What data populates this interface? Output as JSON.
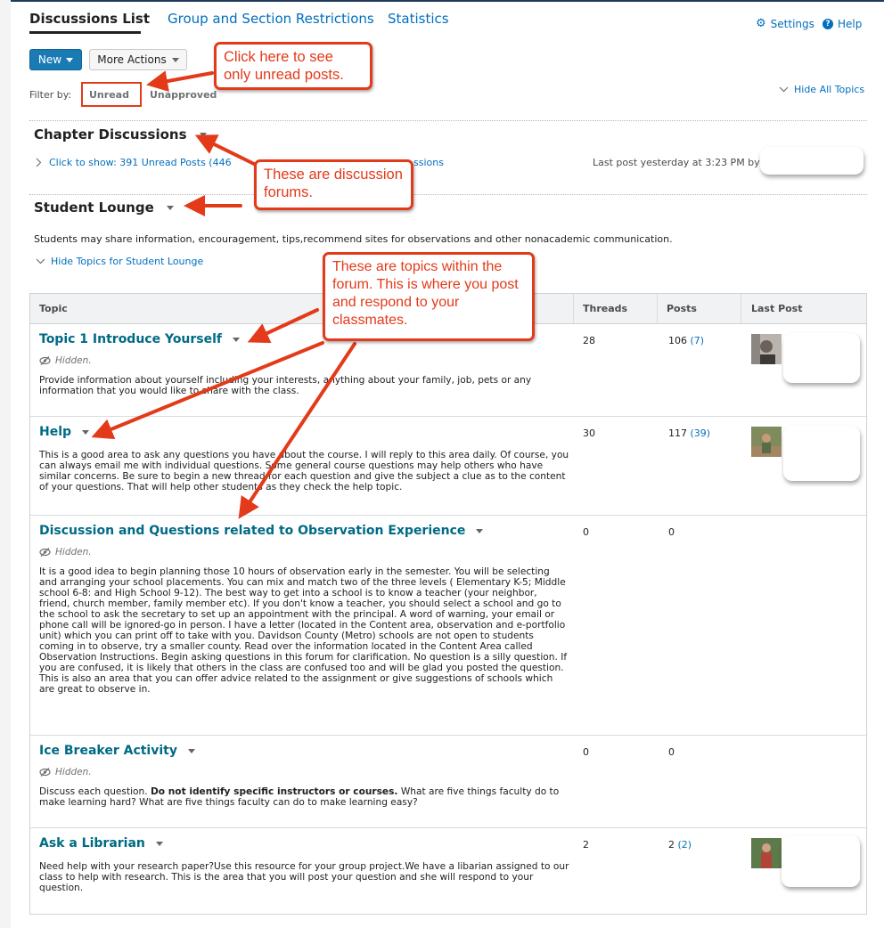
{
  "nav": {
    "tabs": [
      {
        "label": "Discussions List",
        "active": true
      },
      {
        "label": "Group and Section Restrictions",
        "active": false
      },
      {
        "label": "Statistics",
        "active": false
      }
    ],
    "settings_label": "Settings",
    "help_label": "Help"
  },
  "toolbar": {
    "new_label": "New",
    "more_actions_label": "More Actions"
  },
  "filter": {
    "label": "Filter by:",
    "unread": "Unread",
    "unapproved": "Unapproved"
  },
  "hide_all_topics": "Hide All Topics",
  "forums": {
    "chapter": {
      "title": "Chapter Discussions",
      "show_link": "Click to show: 391 Unread Posts (446",
      "show_link_tail": "ssions",
      "last_post": "Last post yesterday at 3:23 PM by"
    },
    "lounge": {
      "title": "Student Lounge",
      "description": "Students may share information, encouragement, tips,recommend sites for observations and other nonacademic communication.",
      "hide_link": "Hide Topics for Student Lounge"
    }
  },
  "table": {
    "headers": {
      "topic": "Topic",
      "threads": "Threads",
      "posts": "Posts",
      "last_post": "Last Post"
    },
    "rows": [
      {
        "title": "Topic 1 Introduce Yourself",
        "hidden": "Hidden.",
        "description": "Provide information about yourself including your interests, anything about your family, job, pets or any information that you would like to share with the class.",
        "threads": "28",
        "posts": "106",
        "unread": "(7)"
      },
      {
        "title": "Help",
        "description": "This is a good area to ask any questions you have about the course. I will reply to this area daily. Of course, you can always email me with individual questions. Some general course questions may help others who have similar concerns. Be sure to begin a new thread for each question and give the subject a clue as to the content of your questions. That will help other students as they check the help topic.",
        "threads": "30",
        "posts": "117",
        "unread": "(39)"
      },
      {
        "title": "Discussion and Questions related to Observation Experience",
        "hidden": "Hidden.",
        "description": "It is a good idea to begin planning those 10 hours of observation early in the semester. You will be selecting and arranging your school placements. You can mix and match two of the three levels ( Elementary K-5; Middle school 6-8: and High School 9-12). The best way to get into a school is to know a teacher (your neighbor, friend, church member, family member etc). If you don't know a teacher, you should select a school and go to the school to ask the secretary to set up an appointment with the principal. A word of warning, your email or phone call will be ignored-go in person. I have a letter (located in the Content area, observation and e-portfolio unit) which you can print off to take with you. Davidson County (Metro) schools are not open to students coming in to observe, try a smaller county. Read over the information located in the Content Area called Observation Instructions. Begin asking questions in this forum for clarification. No question is a silly question. If you are confused, it is likely that others in the class are confused too and will be glad you posted the question. This is also an area that you can offer advice related to the assignment or give suggestions of schools which are great to observe in.",
        "threads": "0",
        "posts": "0"
      },
      {
        "title": "Ice Breaker Activity",
        "hidden": "Hidden.",
        "description_pre": "Discuss each question. ",
        "description_bold": "Do not identify specific instructors or courses.",
        "description_post": " What are five things faculty do to make learning hard? What are five things faculty can do to make learning easy?",
        "threads": "0",
        "posts": "0"
      },
      {
        "title": "Ask a Librarian",
        "description": "Need help with your research paper?Use this resource for your group project.We have a libarian assigned to our class to help with research. This is the area that you will post your question and she will respond to your question.",
        "threads": "2",
        "posts": "2",
        "unread": "(2)"
      }
    ]
  },
  "annotations": {
    "unread_tip": "Click here to see only unread posts.",
    "forums_tip": "These are discussion forums.",
    "topics_tip": "These are topics within the forum. This is where you post and respond to your classmates."
  },
  "colors": {
    "link": "#006fbf",
    "topic_title": "#006a85",
    "primary_button": "#1a7bb4",
    "annotation_red": "#e33a1a"
  }
}
